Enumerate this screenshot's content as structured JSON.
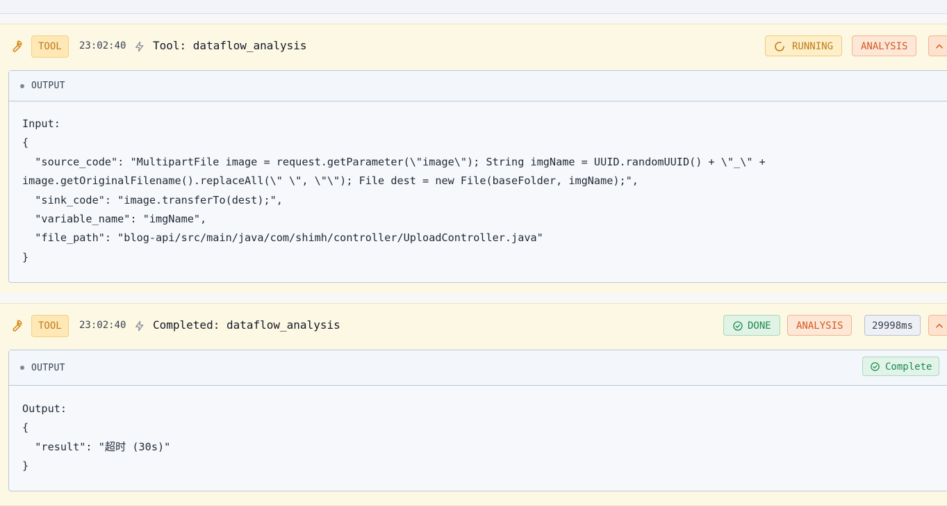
{
  "cards": [
    {
      "tag": "TOOL",
      "time": "23:02:40",
      "title": "Tool: dataflow_analysis",
      "status_label": "RUNNING",
      "category": "ANALYSIS",
      "panel_label": "OUTPUT",
      "code_lines": [
        "Input:",
        "{",
        "  \"source_code\": \"MultipartFile image = request.getParameter(\\\"image\\\"); String imgName = UUID.randomUUID() + \\\"_\\\" +",
        "image.getOriginalFilename().replaceAll(\\\" \\\", \\\"\\\"); File dest = new File(baseFolder, imgName);\",",
        "  \"sink_code\": \"image.transferTo(dest);\",",
        "  \"variable_name\": \"imgName\",",
        "  \"file_path\": \"blog-api/src/main/java/com/shimh/controller/UploadController.java\"",
        "}"
      ]
    },
    {
      "tag": "TOOL",
      "time": "23:02:40",
      "title": "Completed: dataflow_analysis",
      "status_label": "DONE",
      "category": "ANALYSIS",
      "duration": "29998ms",
      "panel_label": "OUTPUT",
      "panel_status": "Complete",
      "code_lines": [
        "Output:",
        "{",
        "  \"result\": \"超时 (30s)\"",
        "}"
      ]
    }
  ],
  "colors": {
    "tool_tag": "#c07a1a",
    "analysis": "#d2591f",
    "done": "#1c8a4d",
    "card_bg": "#fdf8e4"
  },
  "icons": [
    "wrench-icon",
    "bolt-icon",
    "spinner-icon",
    "check-circle-icon",
    "chevron-up-icon"
  ]
}
